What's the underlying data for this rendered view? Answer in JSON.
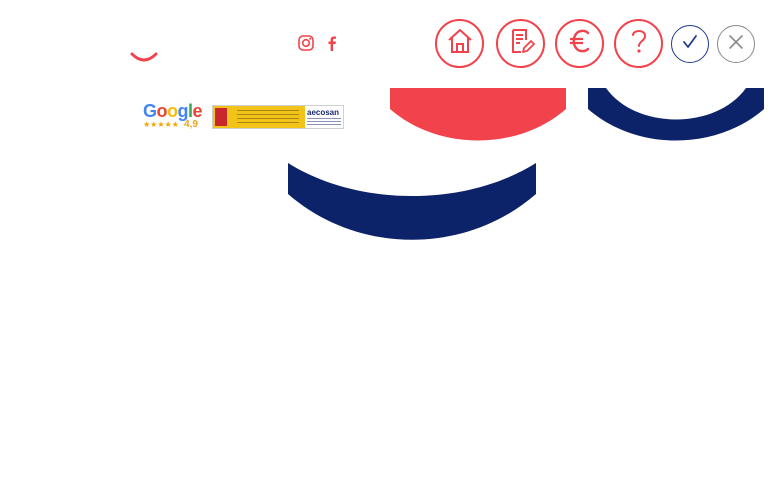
{
  "header": {
    "social": [
      {
        "name": "instagram-icon"
      },
      {
        "name": "facebook-icon"
      }
    ],
    "badges": {
      "google": {
        "brand": "Google",
        "rating": "4,9",
        "stars": 5
      },
      "government": {
        "brand": "aecosan"
      }
    },
    "nav_icons": [
      "home-icon",
      "edit-document-icon",
      "euro-icon",
      "question-mark-icon"
    ],
    "actions": [
      "check-icon",
      "close-icon"
    ]
  },
  "colors": {
    "accent_red": "#f2424b",
    "navy": "#0c2269",
    "white": "#ffffff"
  }
}
